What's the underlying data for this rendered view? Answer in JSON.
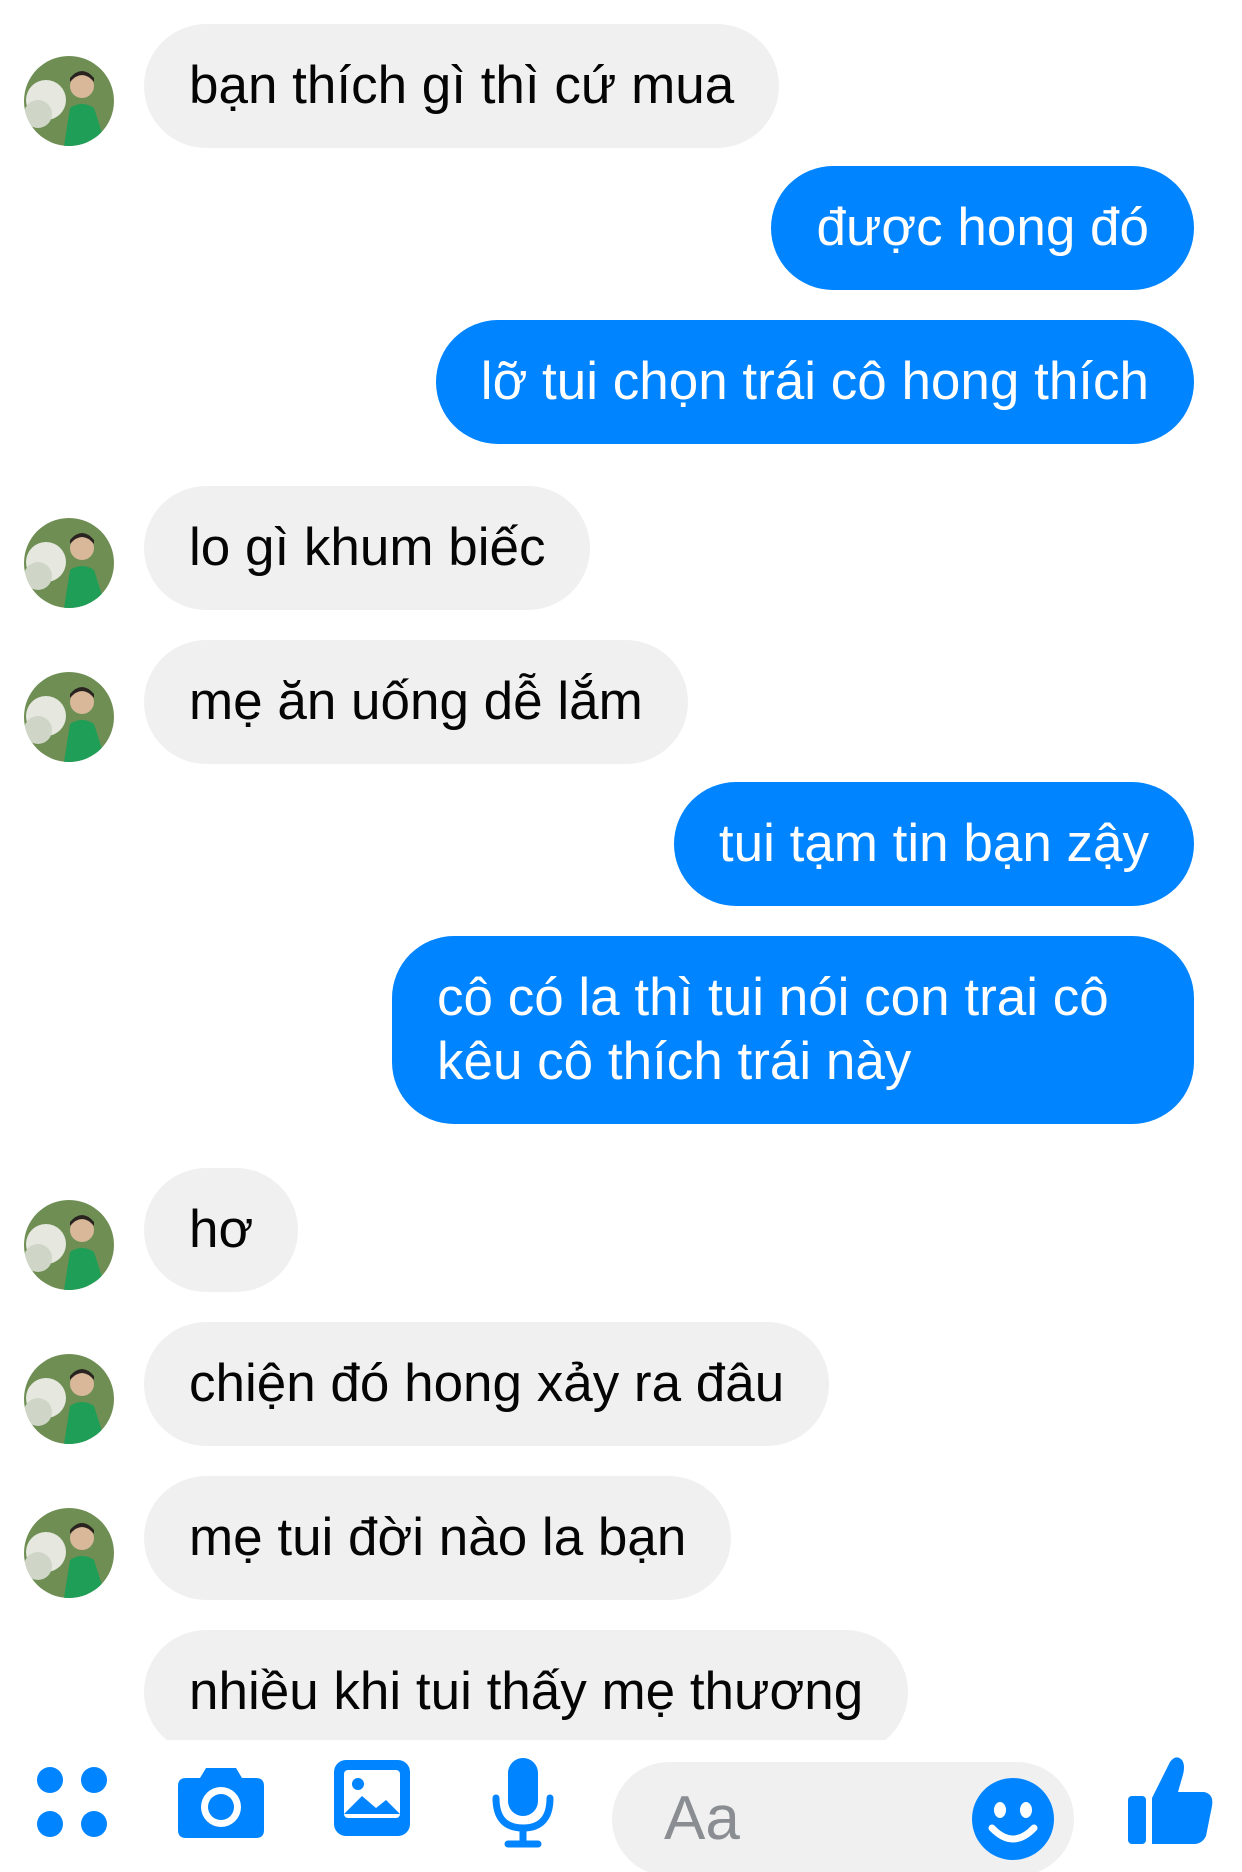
{
  "messages": [
    {
      "direction": "in",
      "text": "bạn thích gì thì cứ mua"
    },
    {
      "direction": "out",
      "text": "được hong đó"
    },
    {
      "direction": "out",
      "text": "lỡ tui chọn trái cô hong thích"
    },
    {
      "direction": "in",
      "text": "lo gì khum biếc"
    },
    {
      "direction": "in",
      "text": "mẹ ăn uống dễ lắm"
    },
    {
      "direction": "out",
      "text": "tui tạm tin bạn zậy"
    },
    {
      "direction": "out",
      "text": "cô có la thì tui nói con trai cô kêu cô thích trái này"
    },
    {
      "direction": "in",
      "text": "hơ"
    },
    {
      "direction": "in",
      "text": "chiện đó hong xảy ra đâu"
    },
    {
      "direction": "in",
      "text": "mẹ tui đời nào la bạn"
    },
    {
      "direction": "in",
      "text": "nhiều khi tui thấy mẹ thương"
    }
  ],
  "composer": {
    "placeholder": "Aa",
    "icons": [
      "apps-icon",
      "camera-icon",
      "gallery-icon",
      "microphone-icon",
      "emoji-icon",
      "thumbs-up-icon"
    ]
  },
  "colors": {
    "outgoing_bubble": "#0084ff",
    "incoming_bubble": "#f0f0f0",
    "accent": "#0084ff"
  }
}
